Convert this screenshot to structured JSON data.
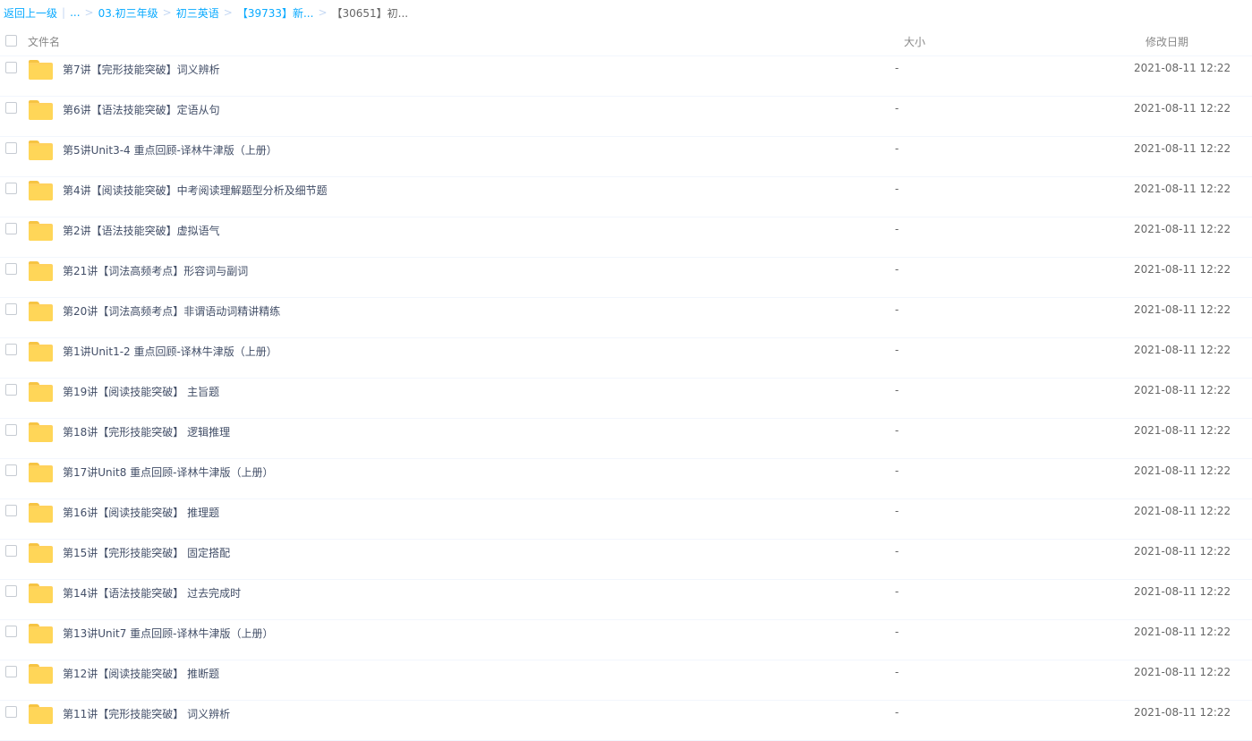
{
  "breadcrumb": {
    "back": "返回上一级",
    "ellipsis": "...",
    "items": [
      "03.初三年级",
      "初三英语",
      "【39733】新..."
    ],
    "current": "【30651】初..."
  },
  "header": {
    "name": "文件名",
    "size": "大小",
    "date": "修改日期"
  },
  "rows": [
    {
      "name": "第7讲【完形技能突破】词义辨析",
      "size": "-",
      "date": "2021-08-11 12:22"
    },
    {
      "name": "第6讲【语法技能突破】定语从句",
      "size": "-",
      "date": "2021-08-11 12:22"
    },
    {
      "name": "第5讲Unit3-4 重点回顾-译林牛津版（上册）",
      "size": "-",
      "date": "2021-08-11 12:22"
    },
    {
      "name": "第4讲【阅读技能突破】中考阅读理解题型分析及细节题",
      "size": "-",
      "date": "2021-08-11 12:22"
    },
    {
      "name": "第2讲【语法技能突破】虚拟语气",
      "size": "-",
      "date": "2021-08-11 12:22"
    },
    {
      "name": "第21讲【词法高频考点】形容词与副词",
      "size": "-",
      "date": "2021-08-11 12:22"
    },
    {
      "name": "第20讲【词法高频考点】非谓语动词精讲精练",
      "size": "-",
      "date": "2021-08-11 12:22"
    },
    {
      "name": "第1讲Unit1-2 重点回顾-译林牛津版（上册）",
      "size": "-",
      "date": "2021-08-11 12:22"
    },
    {
      "name": "第19讲【阅读技能突破】 主旨题",
      "size": "-",
      "date": "2021-08-11 12:22"
    },
    {
      "name": "第18讲【完形技能突破】 逻辑推理",
      "size": "-",
      "date": "2021-08-11 12:22"
    },
    {
      "name": "第17讲Unit8 重点回顾-译林牛津版（上册）",
      "size": "-",
      "date": "2021-08-11 12:22"
    },
    {
      "name": "第16讲【阅读技能突破】 推理题",
      "size": "-",
      "date": "2021-08-11 12:22"
    },
    {
      "name": "第15讲【完形技能突破】 固定搭配",
      "size": "-",
      "date": "2021-08-11 12:22"
    },
    {
      "name": "第14讲【语法技能突破】 过去完成时",
      "size": "-",
      "date": "2021-08-11 12:22"
    },
    {
      "name": "第13讲Unit7 重点回顾-译林牛津版（上册）",
      "size": "-",
      "date": "2021-08-11 12:22"
    },
    {
      "name": "第12讲【阅读技能突破】 推断题",
      "size": "-",
      "date": "2021-08-11 12:22"
    },
    {
      "name": "第11讲【完形技能突破】 词义辨析",
      "size": "-",
      "date": "2021-08-11 12:22"
    }
  ],
  "icons": {
    "folder": "folder-icon",
    "checkbox": "checkbox"
  },
  "colors": {
    "link": "#09aaff",
    "folder": "#ffd25c",
    "text": "#424e67"
  }
}
